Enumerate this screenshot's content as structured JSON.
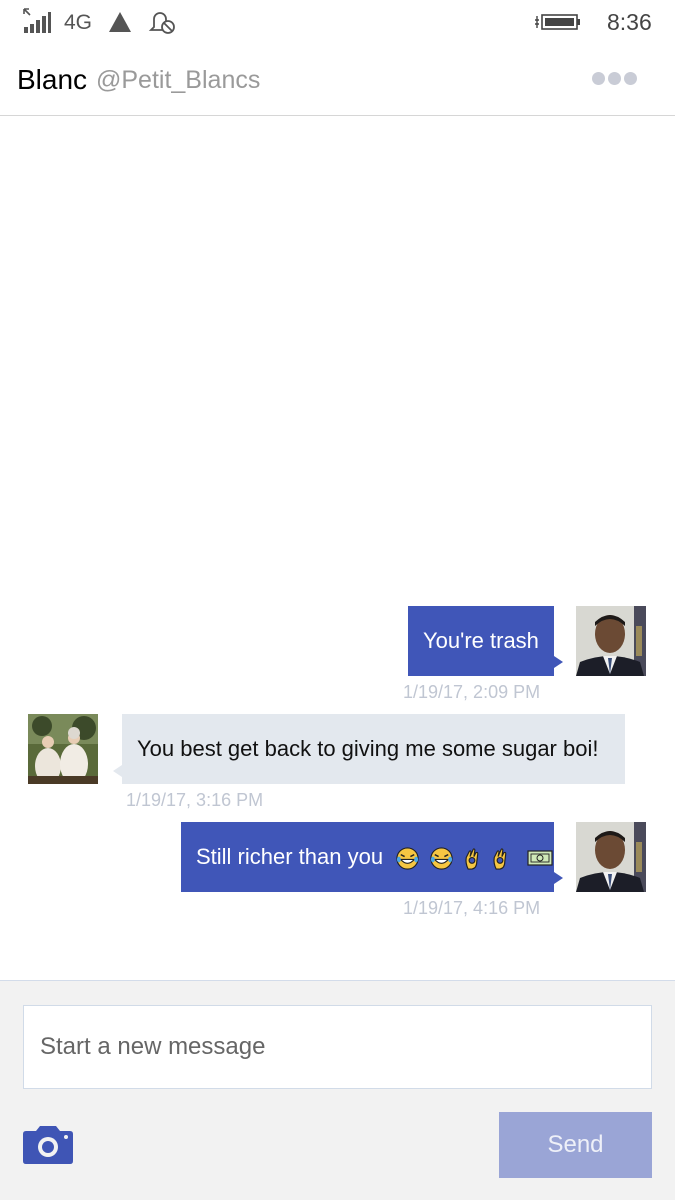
{
  "status_bar": {
    "network": "4G",
    "time": "8:36",
    "icons": [
      "signal-icon",
      "warning-triangle-icon",
      "quiet-hours-bell-icon",
      "battery-icon"
    ]
  },
  "header": {
    "name": "Blanc",
    "handle": "@Petit_Blancs",
    "more_icon": "more-dots-icon"
  },
  "messages": [
    {
      "direction": "outgoing",
      "text": "You're trash",
      "timestamp": "1/19/17, 2:09 PM"
    },
    {
      "direction": "incoming",
      "text": "You best get back to giving me some sugar boi!",
      "timestamp": "1/19/17, 3:16 PM"
    },
    {
      "direction": "outgoing",
      "text": "Still richer than you",
      "emojis": [
        "laughing-tears-emoji",
        "laughing-tears-emoji",
        "ok-hand-emoji",
        "ok-hand-emoji",
        "dollar-bill-emoji"
      ],
      "timestamp": "1/19/17, 4:16 PM"
    }
  ],
  "compose": {
    "placeholder": "Start a new message",
    "send_label": "Send",
    "camera_icon": "camera-icon"
  },
  "colors": {
    "outgoing_bubble": "#4056b8",
    "incoming_bubble": "#e3e8ee",
    "send_button": "#9aa5d6",
    "timestamp": "#c0c6d2"
  }
}
